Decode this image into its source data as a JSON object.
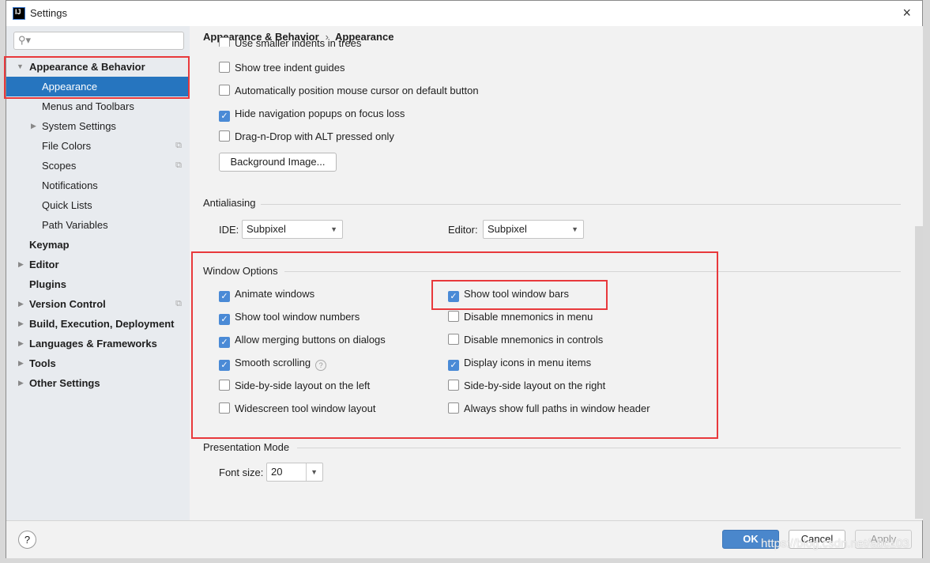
{
  "window": {
    "title": "Settings",
    "logo": "IJ",
    "close": "×"
  },
  "sidebar": {
    "search_placeholder": "",
    "search_icon": "⚲▾",
    "items": [
      {
        "label": "Appearance & Behavior",
        "expanded": true
      },
      {
        "label": "Appearance",
        "selected": true
      },
      {
        "label": "Menus and Toolbars"
      },
      {
        "label": "System Settings"
      },
      {
        "label": "File Colors"
      },
      {
        "label": "Scopes"
      },
      {
        "label": "Notifications"
      },
      {
        "label": "Quick Lists"
      },
      {
        "label": "Path Variables"
      },
      {
        "label": "Keymap"
      },
      {
        "label": "Editor"
      },
      {
        "label": "Plugins"
      },
      {
        "label": "Version Control"
      },
      {
        "label": "Build, Execution, Deployment"
      },
      {
        "label": "Languages & Frameworks"
      },
      {
        "label": "Tools"
      },
      {
        "label": "Other Settings"
      }
    ]
  },
  "breadcrumb": {
    "parent": "Appearance & Behavior",
    "sep": "›",
    "current": "Appearance"
  },
  "ui_options": [
    {
      "label": "Use smaller indents in trees",
      "checked": false
    },
    {
      "label": "Show tree indent guides",
      "checked": false
    },
    {
      "label": "Automatically position mouse cursor on default button",
      "checked": false
    },
    {
      "label": "Hide navigation popups on focus loss",
      "checked": true
    },
    {
      "label": "Drag-n-Drop with ALT pressed only",
      "checked": false
    }
  ],
  "background_image_button": "Background Image...",
  "antialiasing": {
    "title": "Antialiasing",
    "ide_label": "IDE:",
    "ide_value": "Subpixel",
    "editor_label": "Editor:",
    "editor_value": "Subpixel"
  },
  "window_options": {
    "title": "Window Options",
    "left": [
      {
        "label": "Animate windows",
        "checked": true
      },
      {
        "label": "Show tool window numbers",
        "checked": true
      },
      {
        "label": "Allow merging buttons on dialogs",
        "checked": true
      },
      {
        "label": "Smooth scrolling",
        "checked": true
      },
      {
        "label": "Side-by-side layout on the left",
        "checked": false
      },
      {
        "label": "Widescreen tool window layout",
        "checked": false
      }
    ],
    "right": [
      {
        "label": "Show tool window bars",
        "checked": true
      },
      {
        "label": "Disable mnemonics in menu",
        "checked": false
      },
      {
        "label": "Disable mnemonics in controls",
        "checked": false
      },
      {
        "label": "Display icons in menu items",
        "checked": true
      },
      {
        "label": "Side-by-side layout on the right",
        "checked": false
      },
      {
        "label": "Always show full paths in window header",
        "checked": false
      }
    ]
  },
  "presentation": {
    "title": "Presentation Mode",
    "font_size_label": "Font size:",
    "font_size_value": "20"
  },
  "footer": {
    "help": "?",
    "ok": "OK",
    "cancel": "Cancel",
    "apply": "Apply"
  },
  "watermark": "https://blog.csdn.net/abc103",
  "colors": {
    "accent": "#2675bf",
    "highlight": "#e8393c",
    "checkbox": "#4a8ad6"
  }
}
